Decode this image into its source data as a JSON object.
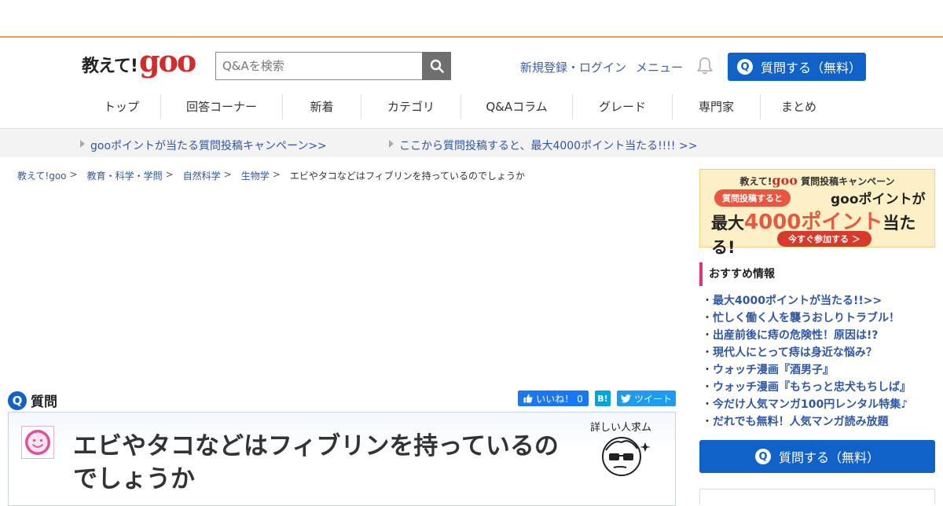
{
  "header": {
    "logo_text": "教えて!",
    "logo_brand": "goo",
    "search_placeholder": "Q&Aを検索",
    "login_link": "新規登録・ログイン",
    "menu_link": "メニュー",
    "ask_button": "質問する（無料）"
  },
  "nav": {
    "items": [
      "トップ",
      "回答コーナー",
      "新着",
      "カテゴリ",
      "Q&Aコラム",
      "グレード",
      "専門家",
      "まとめ"
    ]
  },
  "campaign": {
    "link1": "gooポイントが当たる質問投稿キャンペーン>>",
    "link2": "ここから質問投稿すると、最大4000ポイント当たる!!!! >>"
  },
  "breadcrumb": {
    "items": [
      "教えて!goo",
      "教育・科学・学問",
      "自然科学",
      "生物学"
    ],
    "current": "エビやタコなどはフィブリンを持っているのでしょうか"
  },
  "question": {
    "label": "質問",
    "title": "エビやタコなどはフィブリンを持っているのでしょうか",
    "tag": "詳しい人求ム"
  },
  "share": {
    "like": "いいね！ 0",
    "hatena": "B!",
    "tweet": "ツイート"
  },
  "banner": {
    "top_prefix": "教えて!",
    "top_brand": "goo",
    "top_suffix": "質問投稿キャンペーン",
    "pill": "質問投稿すると",
    "mid": "gooポイントが",
    "big_prefix": "最大",
    "big_number": "4000ポイント",
    "big_suffix": "当たる!",
    "join": "今すぐ参加する ＞"
  },
  "recommend": {
    "heading": "おすすめ情報",
    "items": [
      "最大4000ポイントが当たる!!>>",
      "忙しく働く人を襲うおしりトラブル！",
      "出産前後に痔の危険性！原因は!?",
      "現代人にとって痔は身近な悩み？",
      "ウォッチ漫画『酒男子』",
      "ウォッチ漫画『もちっと忠犬もちしば』",
      "今だけ人気マンガ100円レンタル特集♪",
      "だれでも無料！人気マンガ読み放題"
    ]
  },
  "sidebar_ask": "質問する（無料）",
  "colors": {
    "accent_orange": "#f39b4c",
    "primary_blue": "#1062c8",
    "link_blue": "#2e57a7",
    "brand_red": "#d62b2b"
  }
}
